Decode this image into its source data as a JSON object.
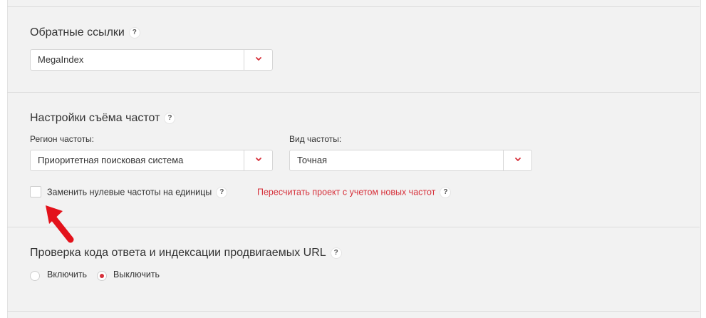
{
  "backlinks": {
    "title": "Обратные ссылки",
    "help": "?",
    "selected": "MegaIndex"
  },
  "frequency": {
    "title": "Настройки съёма частот",
    "help": "?",
    "region_label": "Регион частоты:",
    "region_selected": "Приоритетная поисковая система",
    "type_label": "Вид частоты:",
    "type_selected": "Точная",
    "replace_zero_label": "Заменить нулевые частоты на единицы",
    "replace_zero_help": "?",
    "recalc_link": "Пересчитать проект с учетом новых частот",
    "recalc_help": "?"
  },
  "url_check": {
    "title": "Проверка кода ответа и индексации продвигаемых URL",
    "help": "?",
    "option_enable": "Включить",
    "option_disable": "Выключить"
  },
  "colors": {
    "accent": "#d6303a",
    "panel_bg": "#f2f2f2"
  }
}
